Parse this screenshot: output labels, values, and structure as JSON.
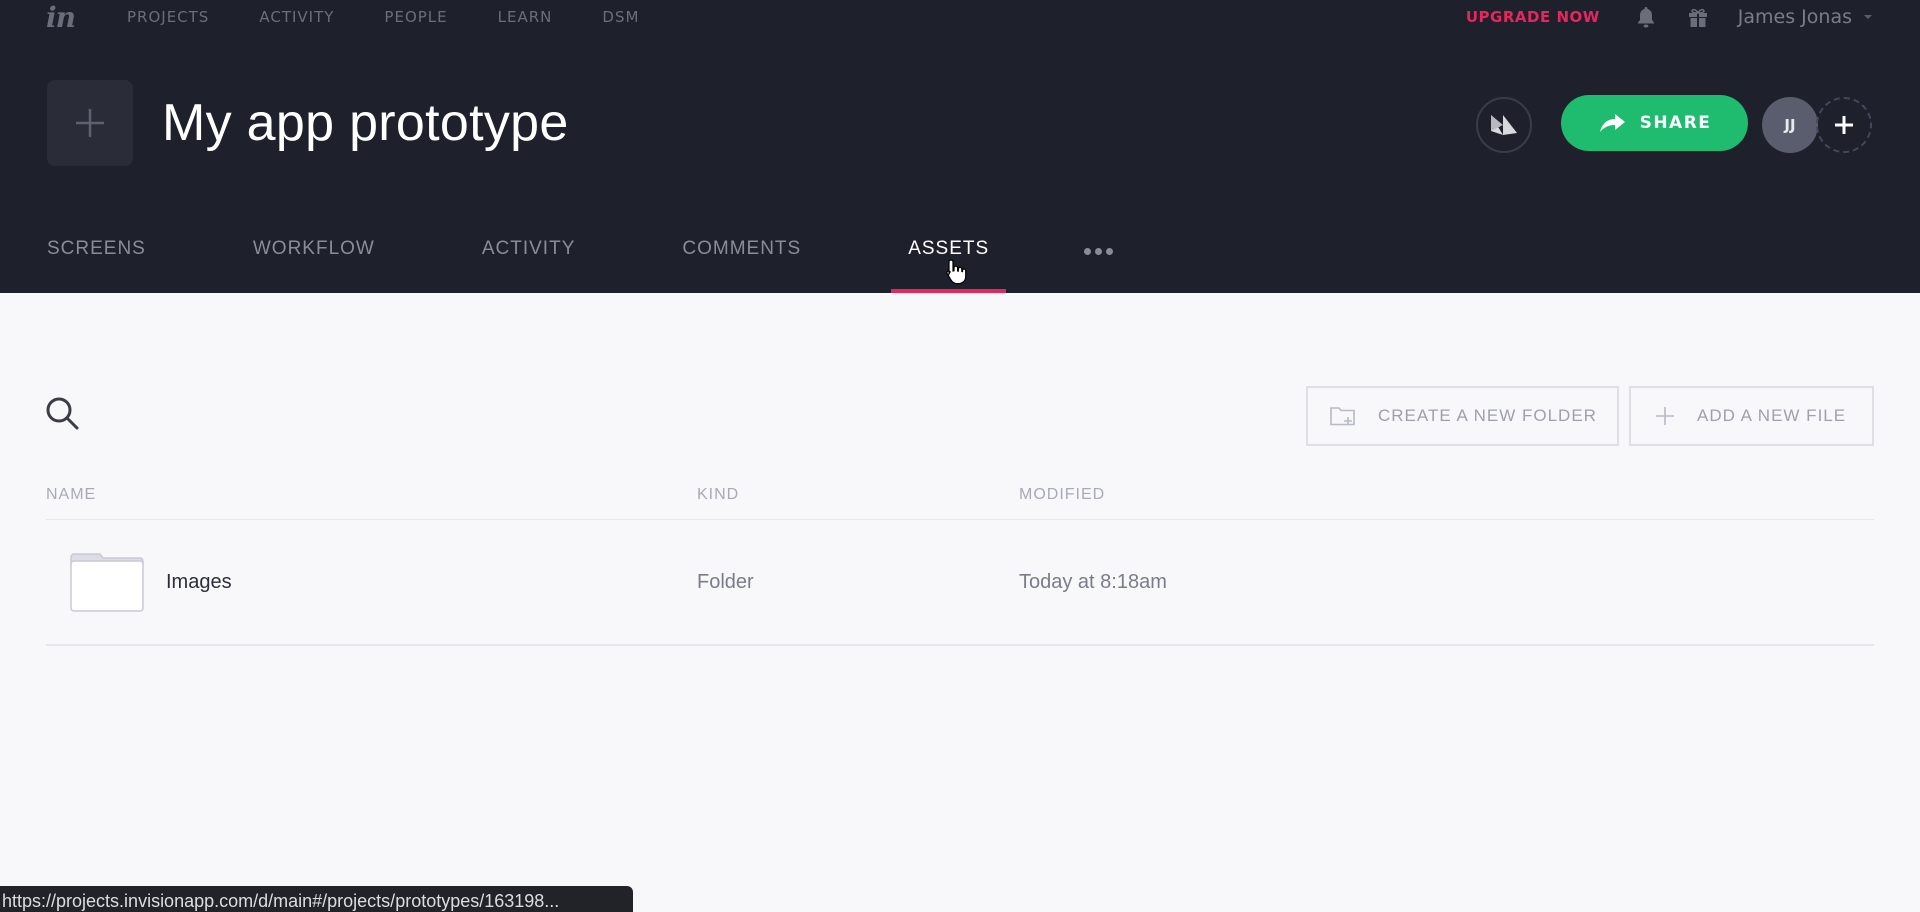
{
  "topnav": {
    "logo": "in",
    "items": [
      "PROJECTS",
      "ACTIVITY",
      "PEOPLE",
      "LEARN",
      "DSM"
    ],
    "upgrade_label": "UPGRADE NOW",
    "user_name": "James Jonas",
    "icons": [
      "bell-icon",
      "gift-icon"
    ]
  },
  "project": {
    "title": "My app prototype",
    "share_label": "SHARE",
    "avatar_initials": "JJ"
  },
  "tabs": [
    {
      "label": "SCREENS",
      "active": false
    },
    {
      "label": "WORKFLOW",
      "active": false
    },
    {
      "label": "ACTIVITY",
      "active": false
    },
    {
      "label": "COMMENTS",
      "active": false
    },
    {
      "label": "ASSETS",
      "active": true
    }
  ],
  "toolbar": {
    "create_folder_label": "CREATE A NEW FOLDER",
    "add_file_label": "ADD A NEW FILE"
  },
  "table": {
    "headers": {
      "name": "NAME",
      "kind": "KIND",
      "modified": "MODIFIED"
    },
    "rows": [
      {
        "name": "Images",
        "kind": "Folder",
        "modified": "Today at 8:18am"
      }
    ]
  },
  "status_url": "https://projects.invisionapp.com/d/main#/projects/prototypes/163198...",
  "colors": {
    "header_bg": "#1e202b",
    "accent_pink": "#e8265e",
    "share_green": "#1fbb6e",
    "content_bg": "#f8f8fa"
  }
}
